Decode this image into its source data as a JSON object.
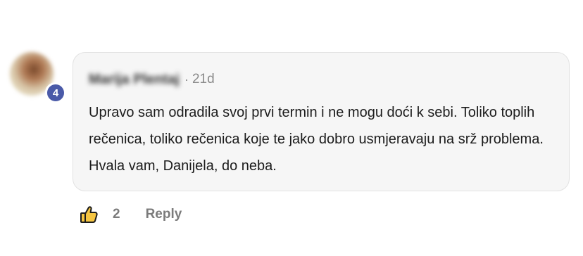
{
  "comment": {
    "author": "Marija Plentaj",
    "separator": "·",
    "time": "21d",
    "level": "4",
    "text": "Upravo sam odradila svoj prvi termin i ne mogu doći k sebi. Toliko toplih rečenica, toliko rečenica koje te jako dobro usmjeravaju na srž problema. Hvala vam, Danijela, do neba.",
    "likes": "2",
    "reply_label": "Reply"
  },
  "icons": {
    "like": "thumbs-up-icon"
  },
  "colors": {
    "badge": "#4a5aa8",
    "bubble_bg": "#f6f6f6",
    "muted_text": "#7b7b7b",
    "like_yellow": "#f5c542"
  }
}
